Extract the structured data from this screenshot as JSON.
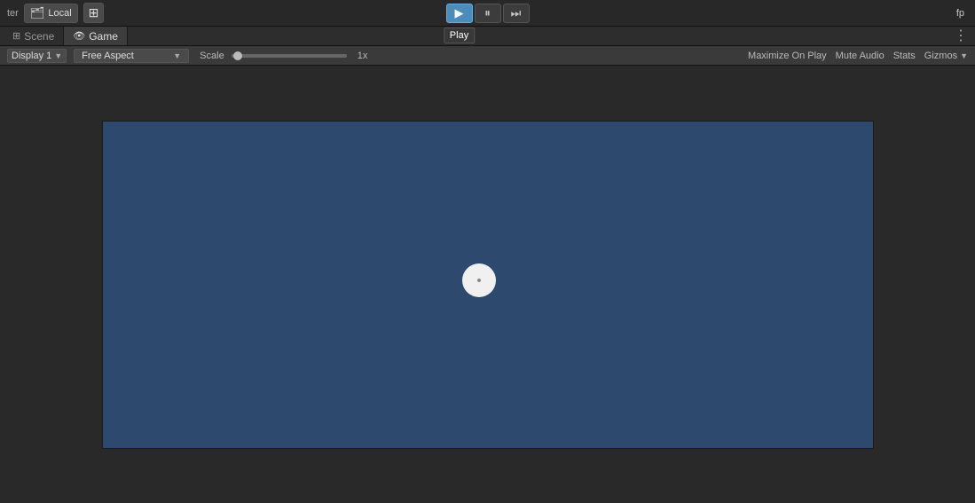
{
  "toolbar": {
    "local_label": "Local",
    "grid_icon": "⊞",
    "play_label": "Play",
    "pause_icon": "⏸",
    "step_icon": "⏭",
    "play_icon": "▶",
    "more_icon": "⋮"
  },
  "tabs": {
    "scene_label": "Scene",
    "game_label": "Game",
    "scene_icon": "⊞",
    "game_icon": "👁"
  },
  "options_bar": {
    "display_label": "Display 1",
    "aspect_label": "Free Aspect",
    "scale_label": "Scale",
    "scale_value": "1x",
    "maximize_label": "Maximize On Play",
    "mute_label": "Mute Audio",
    "stats_label": "Stats",
    "gizmos_label": "Gizmos"
  },
  "colors": {
    "toolbar_bg": "#282828",
    "tab_bar_bg": "#2d2d2d",
    "options_bar_bg": "#3a3a3a",
    "viewport_bg": "#292929",
    "game_view_bg": "#2d4a6e",
    "active_tab_bg": "#3d3d3d",
    "play_btn_bg": "#4c8cba"
  }
}
